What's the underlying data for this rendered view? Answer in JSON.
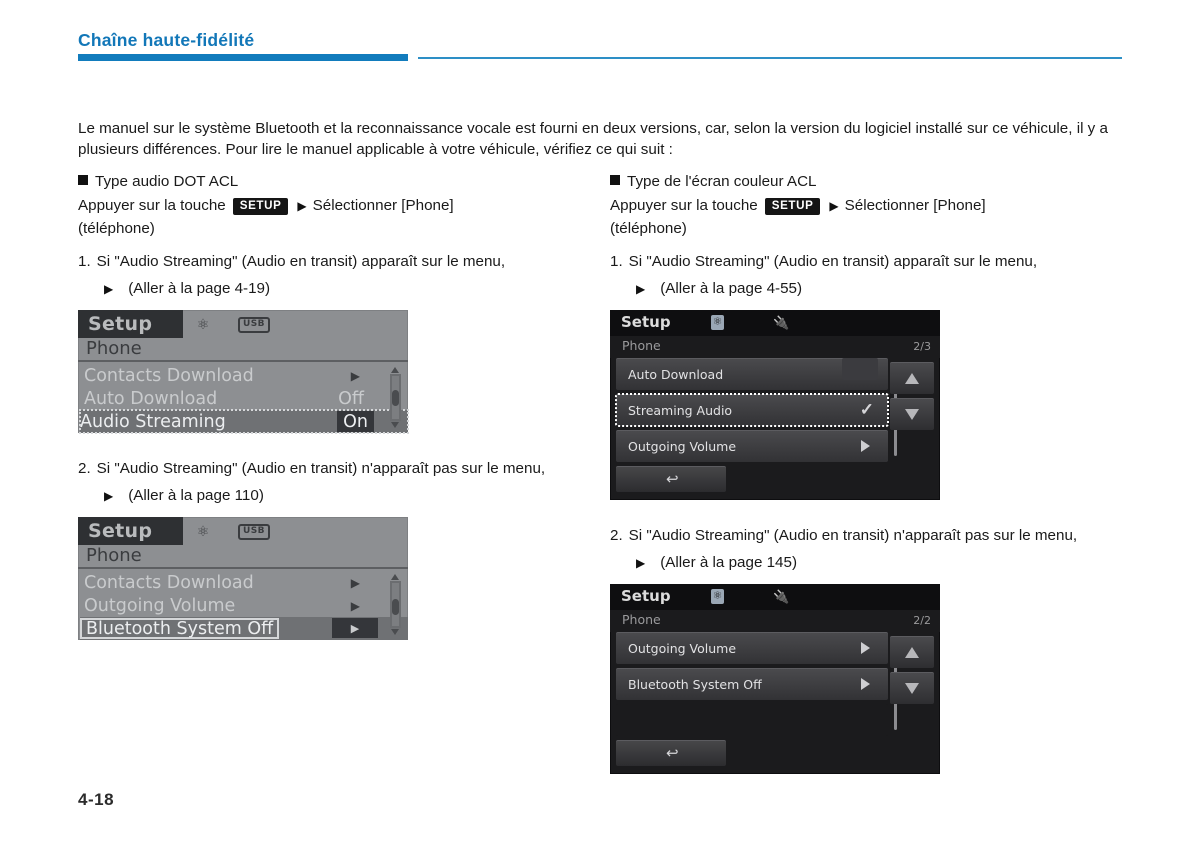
{
  "header": {
    "title": "Chaîne haute-fidélité",
    "accent_color": "#127cbd"
  },
  "intro": "Le manuel sur le système Bluetooth et la reconnaissance vocale est fourni en deux versions, car, selon la version du logiciel installé sur ce véhicule, il y a plusieurs différences. Pour lire le manuel applicable à votre véhicule, vérifiez ce qui suit :",
  "left_column": {
    "section_title": "Type audio DOT ACL",
    "press_prefix": "Appuyer sur la touche",
    "key_label": "SETUP",
    "press_suffix": "Sélectionner [Phone]",
    "press_paren": "(téléphone)",
    "step1": {
      "num": "1.",
      "text": "Si \"Audio Streaming\" (Audio en transit) apparaît sur le menu,",
      "goto": "(Aller à la page 4-19)"
    },
    "step2": {
      "num": "2.",
      "text": "Si \"Audio Streaming\" (Audio en transit) n'apparaît pas sur le menu,",
      "goto": "(Aller à la page 110)"
    },
    "lcd1": {
      "tab": "Setup",
      "bt_icon": "bluetooth-icon",
      "usb_badge": "USB",
      "submenu": "Phone",
      "rows": [
        {
          "label": "Contacts Download",
          "value": "",
          "arrow": true,
          "selected": false
        },
        {
          "label": "Auto Download",
          "value": "Off",
          "arrow": false,
          "selected": false
        },
        {
          "label": "Audio Streaming",
          "value": "On",
          "arrow": false,
          "selected": true
        }
      ]
    },
    "lcd2": {
      "tab": "Setup",
      "bt_icon": "bluetooth-icon",
      "usb_badge": "USB",
      "submenu": "Phone",
      "rows": [
        {
          "label": "Contacts Download",
          "value": "",
          "arrow": true,
          "selected": false
        },
        {
          "label": "Outgoing Volume",
          "value": "",
          "arrow": true,
          "selected": false
        },
        {
          "label": "Bluetooth System Off",
          "value": "",
          "arrow": true,
          "selected": true
        }
      ]
    }
  },
  "right_column": {
    "section_title": "Type de l'écran couleur ACL",
    "press_prefix": "Appuyer sur la touche",
    "key_label": "SETUP",
    "press_suffix": "Sélectionner [Phone]",
    "press_paren": "(téléphone)",
    "step1": {
      "num": "1.",
      "text": "Si \"Audio Streaming\" (Audio en transit) apparaît sur le menu,",
      "goto": "(Aller à la page 4-55)"
    },
    "step2": {
      "num": "2.",
      "text": "Si \"Audio Streaming\" (Audio en transit) n'apparaît pas sur le menu,",
      "goto": "(Aller à la page 145)"
    },
    "lcd1": {
      "tab": "Setup",
      "bt_icon": "bluetooth-icon",
      "usb_icon": "usb-icon",
      "submenu": "Phone",
      "page_indicator": "2/3",
      "rows": [
        {
          "label": "Auto Download",
          "control": "box",
          "selected": false
        },
        {
          "label": "Streaming Audio",
          "control": "check",
          "selected": true
        },
        {
          "label": "Outgoing Volume",
          "control": "arrow",
          "selected": false
        }
      ],
      "back_icon": "back-arrow-icon"
    },
    "lcd2": {
      "tab": "Setup",
      "bt_icon": "bluetooth-icon",
      "usb_icon": "usb-icon",
      "submenu": "Phone",
      "page_indicator": "2/2",
      "rows": [
        {
          "label": "Outgoing Volume",
          "control": "arrow",
          "selected": false
        },
        {
          "label": "Bluetooth System Off",
          "control": "arrow",
          "selected": false
        }
      ],
      "back_icon": "back-arrow-icon"
    }
  },
  "footer": {
    "page_number": "4-18"
  }
}
